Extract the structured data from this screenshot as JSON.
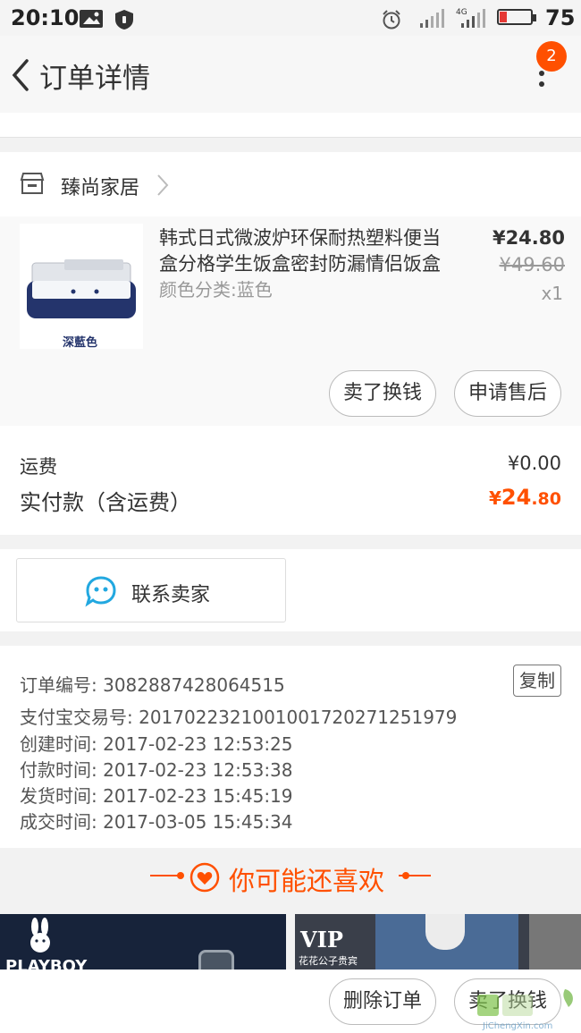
{
  "status_bar": {
    "time": "20:10",
    "battery_pct": "75",
    "network": "4G",
    "colors": {
      "battery_low": "#e53935"
    }
  },
  "navbar": {
    "title": "订单详情",
    "badge_count": "2",
    "icons": [
      "back-chevron-icon",
      "more-vertical-icon"
    ]
  },
  "shop": {
    "name": "臻尚家居",
    "icons": [
      "store-icon",
      "chevron-right-icon"
    ]
  },
  "item": {
    "title": "韩式日式微波炉环保耐热塑料便当盒分格学生饭盒密封防漏情侣饭盒",
    "attr": "颜色分类:蓝色",
    "price": "¥24.80",
    "original_price": "¥49.60",
    "qty": "x1",
    "thumb_label": "深藍色",
    "buttons": {
      "sell": "卖了换钱",
      "after_sale": "申请售后"
    }
  },
  "fees": {
    "shipping_label": "运费",
    "shipping_value": "¥0.00",
    "paid_label": "实付款（含运费）",
    "paid_currency": "¥",
    "paid_int": "24",
    "paid_dec": ".80"
  },
  "contact": {
    "label": "联系卖家",
    "icon": "chat-bubble-icon"
  },
  "order_info": {
    "order_no": "订单编号: 3082887428064515",
    "copy_label": "复制",
    "alipay_no": "支付宝交易号: 2017022321001001720271251979",
    "created": "创建时间: 2017-02-23 12:53:25",
    "paid": "付款时间: 2017-02-23 12:53:38",
    "shipped": "发货时间: 2017-02-23 15:45:19",
    "completed": "成交时间: 2017-03-05 15:45:34"
  },
  "recommend": {
    "title": "你可能还喜欢",
    "items": [
      {
        "brand": "PLAYBOY"
      },
      {
        "brand": "VIP",
        "subtitle": "花花公子贵宾"
      }
    ]
  },
  "bottom_bar": {
    "delete_label": "删除订单",
    "sell_label": "卖了换钱"
  },
  "watermark": {
    "text": "JiChengXin.com"
  },
  "colors": {
    "accent": "#ff5000",
    "chat_icon": "#22a8e0",
    "background": "#f2f2f2"
  }
}
